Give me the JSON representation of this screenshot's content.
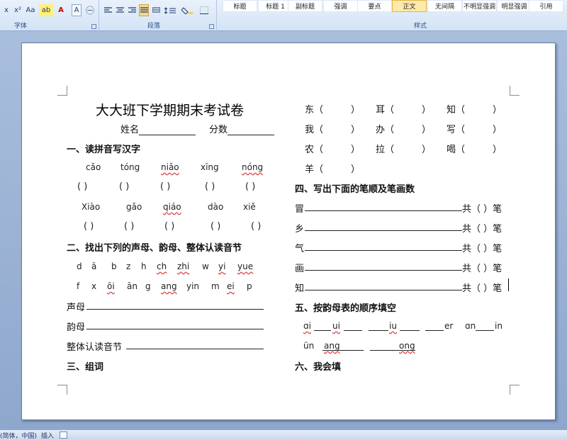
{
  "toolbar": {
    "font_group_label": "字体",
    "para_group_label": "段落",
    "style_group_label": "样式",
    "font_buttons": [
      "x",
      "x²",
      "Aa",
      "ab",
      "A",
      "A",
      "㊀"
    ],
    "styles": [
      "标题",
      "标题 1",
      "副标题",
      "强调",
      "要点",
      "正文",
      "无间隔",
      "不明显强调",
      "明显强调",
      "引用"
    ],
    "active_style": "正文"
  },
  "doc": {
    "title": "大大班下学期期末考试卷",
    "name_label": "姓名",
    "score_label": "分数",
    "s1": "一、读拼音写汉字",
    "pinyin_row1": [
      "cǎo",
      "tóng",
      "niǎo",
      "xīng",
      "nóng"
    ],
    "pinyin_row2": [
      "Xiào",
      "gǎo",
      "qiáo",
      "dào",
      "xiě"
    ],
    "paren": "(      )",
    "s2": "二、找出下列的声母、韵母、整体认读音节",
    "letters_row1": [
      "d",
      "ā",
      "b",
      "z",
      "h",
      "ch",
      "zhi",
      "w",
      "yi",
      "yue"
    ],
    "letters_row2": [
      "f",
      "x",
      "ōi",
      "ān",
      "g",
      "ang",
      "yin",
      "m",
      "ei",
      "p"
    ],
    "shengmu": "声母",
    "yunmu": "韵母",
    "zhengti": "整体认读音节",
    "s3": "三、组词",
    "right_chars": [
      [
        "东",
        "耳",
        "知"
      ],
      [
        "我",
        "办",
        "写"
      ],
      [
        "农",
        "拉",
        "喝"
      ],
      [
        "羊"
      ]
    ],
    "s4": "四、写出下面的笔顺及笔画数",
    "stroke_chars": [
      "冒",
      "乡",
      "气",
      "画",
      "知"
    ],
    "gong": "共（  ）笔",
    "s5": "五、按韵母表的顺序填空",
    "rhyme_row1": [
      "ɑi",
      "ui",
      "iu",
      "er",
      "ɑn",
      "in"
    ],
    "rhyme_row2": [
      "ün",
      "ang",
      "ong"
    ],
    "s6": "六、我会填"
  },
  "status": {
    "lang": "(简体，中国)",
    "mode": "插入"
  },
  "colors": {
    "ribbon": "#dde8f6",
    "canvas": "#9fb6d6",
    "active_style": "#fde9a8",
    "spell_underline": "#e03a3a"
  }
}
